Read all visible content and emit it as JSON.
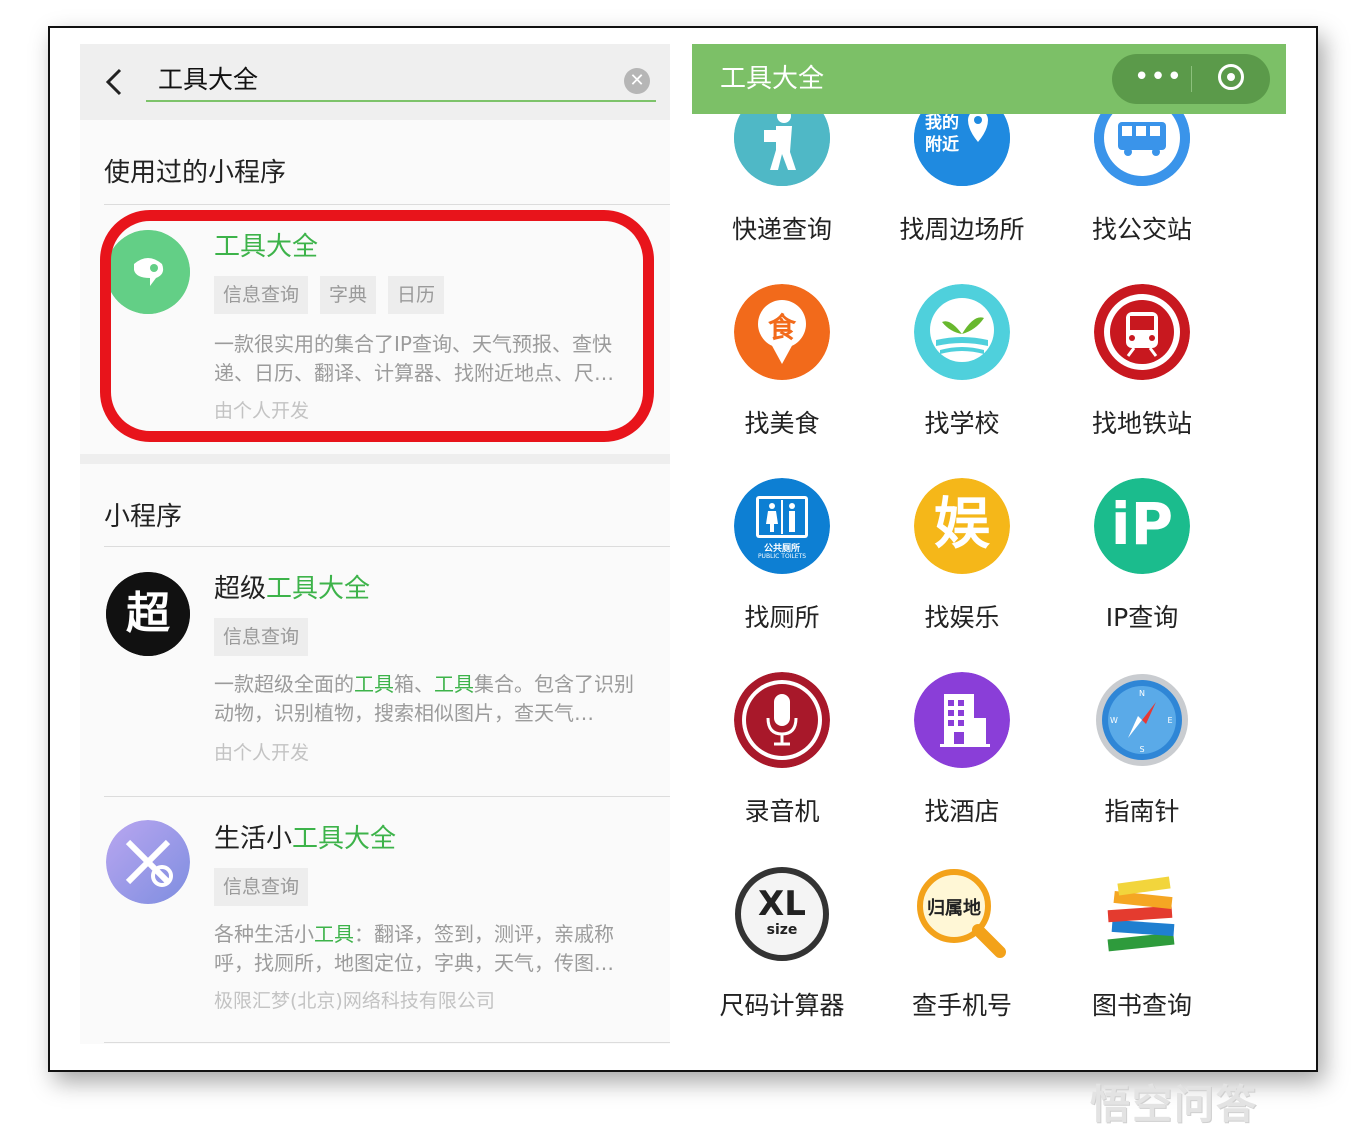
{
  "search": {
    "query": "工具大全"
  },
  "used": {
    "section_title": "使用过的小程序",
    "item": {
      "name": "工具大全",
      "tags": [
        "信息查询",
        "字典",
        "日历"
      ],
      "desc": "一款很实用的集合了IP查询、天气预报、查快递、日历、翻译、计算器、找附近地点、尺…",
      "dev": "由个人开发"
    }
  },
  "mini": {
    "section_title": "小程序",
    "items": [
      {
        "name_pre": "超级",
        "name_hl": "工具大全",
        "name_post": "",
        "tag": "信息查询",
        "desc_parts": [
          "一款超级全面的",
          "工具",
          "箱、",
          "工具",
          "集合。包含了识别动物，识别植物，搜索相似图片，查天气…"
        ],
        "dev": "由个人开发"
      },
      {
        "name_pre": "生活小",
        "name_hl": "工具大全",
        "name_post": "",
        "tag": "信息查询",
        "desc_parts": [
          "各种生活小",
          "工具",
          "：翻译，签到，测评，亲戚称呼，找厕所，地图定位，字典，天气，传图…"
        ],
        "dev": "极限汇梦(北京)网络科技有限公司"
      }
    ]
  },
  "app": {
    "title": "工具大全",
    "grid": [
      {
        "label": "快递查询",
        "icon": "courier-icon"
      },
      {
        "label": "找周边场所",
        "icon": "nearby-location-icon",
        "text": "我的附近"
      },
      {
        "label": "找公交站",
        "icon": "bus-icon"
      },
      {
        "label": "找美食",
        "icon": "food-icon",
        "text": "食"
      },
      {
        "label": "找学校",
        "icon": "school-icon"
      },
      {
        "label": "找地铁站",
        "icon": "subway-icon"
      },
      {
        "label": "找厕所",
        "icon": "toilet-icon",
        "text": "公共厕所",
        "subtext": "PUBLIC TOILETS"
      },
      {
        "label": "找娱乐",
        "icon": "entertainment-icon",
        "text": "娱"
      },
      {
        "label": "IP查询",
        "icon": "ip-icon",
        "text": "iP"
      },
      {
        "label": "录音机",
        "icon": "microphone-icon"
      },
      {
        "label": "找酒店",
        "icon": "hotel-icon"
      },
      {
        "label": "指南针",
        "icon": "compass-icon"
      },
      {
        "label": "尺码计算器",
        "icon": "size-icon",
        "text": "XL",
        "subtext": "size"
      },
      {
        "label": "查手机号",
        "icon": "phone-lookup-icon",
        "text": "归属地"
      },
      {
        "label": "图书查询",
        "icon": "books-icon"
      }
    ]
  },
  "watermark": "悟空问答",
  "colors": {
    "accent": "#3db34a",
    "navbar": "#7cc067",
    "highlight_box": "#e8141b"
  }
}
